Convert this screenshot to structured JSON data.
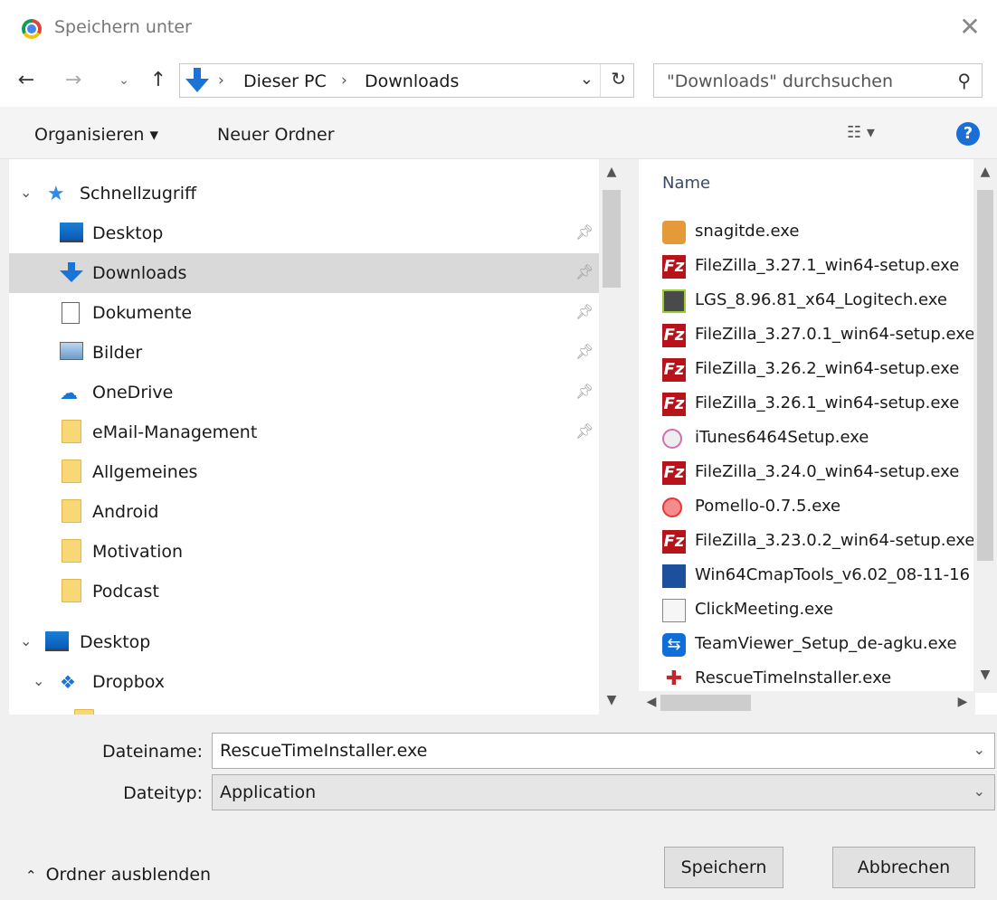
{
  "window": {
    "title": "Speichern unter"
  },
  "address": {
    "crumbs": [
      "Dieser PC",
      "Downloads"
    ]
  },
  "search": {
    "placeholder": "\"Downloads\" durchsuchen"
  },
  "toolbar": {
    "organize_label": "Organisieren ▾",
    "new_folder_label": "Neuer Ordner"
  },
  "tree": {
    "quick_access_label": "Schnellzugriff",
    "items": [
      {
        "label": "Desktop",
        "icon": "desktop-icon",
        "pinned": true
      },
      {
        "label": "Downloads",
        "icon": "downloads-icon",
        "pinned": true,
        "selected": true
      },
      {
        "label": "Dokumente",
        "icon": "documents-icon",
        "pinned": true
      },
      {
        "label": "Bilder",
        "icon": "pictures-icon",
        "pinned": true
      },
      {
        "label": "OneDrive",
        "icon": "onedrive-icon",
        "pinned": true
      },
      {
        "label": "eMail-Management",
        "icon": "folder-icon",
        "pinned": true
      },
      {
        "label": "Allgemeines",
        "icon": "folder-icon",
        "pinned": false
      },
      {
        "label": "Android",
        "icon": "folder-icon",
        "pinned": false
      },
      {
        "label": "Motivation",
        "icon": "folder-icon",
        "pinned": false
      },
      {
        "label": "Podcast",
        "icon": "folder-icon",
        "pinned": false
      }
    ],
    "desktop_label": "Desktop",
    "dropbox_label": "Dropbox"
  },
  "files": {
    "column_header": "Name",
    "items": [
      {
        "name": "snagitde.exe",
        "icon": "snagit-icon"
      },
      {
        "name": "FileZilla_3.27.1_win64-setup.exe",
        "icon": "filezilla-icon"
      },
      {
        "name": "LGS_8.96.81_x64_Logitech.exe",
        "icon": "logitech-icon"
      },
      {
        "name": "FileZilla_3.27.0.1_win64-setup.exe",
        "icon": "filezilla-icon"
      },
      {
        "name": "FileZilla_3.26.2_win64-setup.exe",
        "icon": "filezilla-icon"
      },
      {
        "name": "FileZilla_3.26.1_win64-setup.exe",
        "icon": "filezilla-icon"
      },
      {
        "name": "iTunes6464Setup.exe",
        "icon": "itunes-icon"
      },
      {
        "name": "FileZilla_3.24.0_win64-setup.exe",
        "icon": "filezilla-icon"
      },
      {
        "name": "Pomello-0.7.5.exe",
        "icon": "pomello-icon"
      },
      {
        "name": "FileZilla_3.23.0.2_win64-setup.exe",
        "icon": "filezilla-icon"
      },
      {
        "name": "Win64CmapTools_v6.02_08-11-16",
        "icon": "cmaptools-icon"
      },
      {
        "name": "ClickMeeting.exe",
        "icon": "clickmeeting-icon"
      },
      {
        "name": "TeamViewer_Setup_de-agku.exe",
        "icon": "teamviewer-icon"
      },
      {
        "name": "RescueTimeInstaller.exe",
        "icon": "rescuetime-icon"
      }
    ]
  },
  "form": {
    "filename_label": "Dateiname:",
    "filename_value": "RescueTimeInstaller.exe",
    "filetype_label": "Dateityp:",
    "filetype_value": "Application"
  },
  "footer": {
    "toggle_label": "Ordner ausblenden",
    "save_label": "Speichern",
    "cancel_label": "Abbrechen"
  }
}
